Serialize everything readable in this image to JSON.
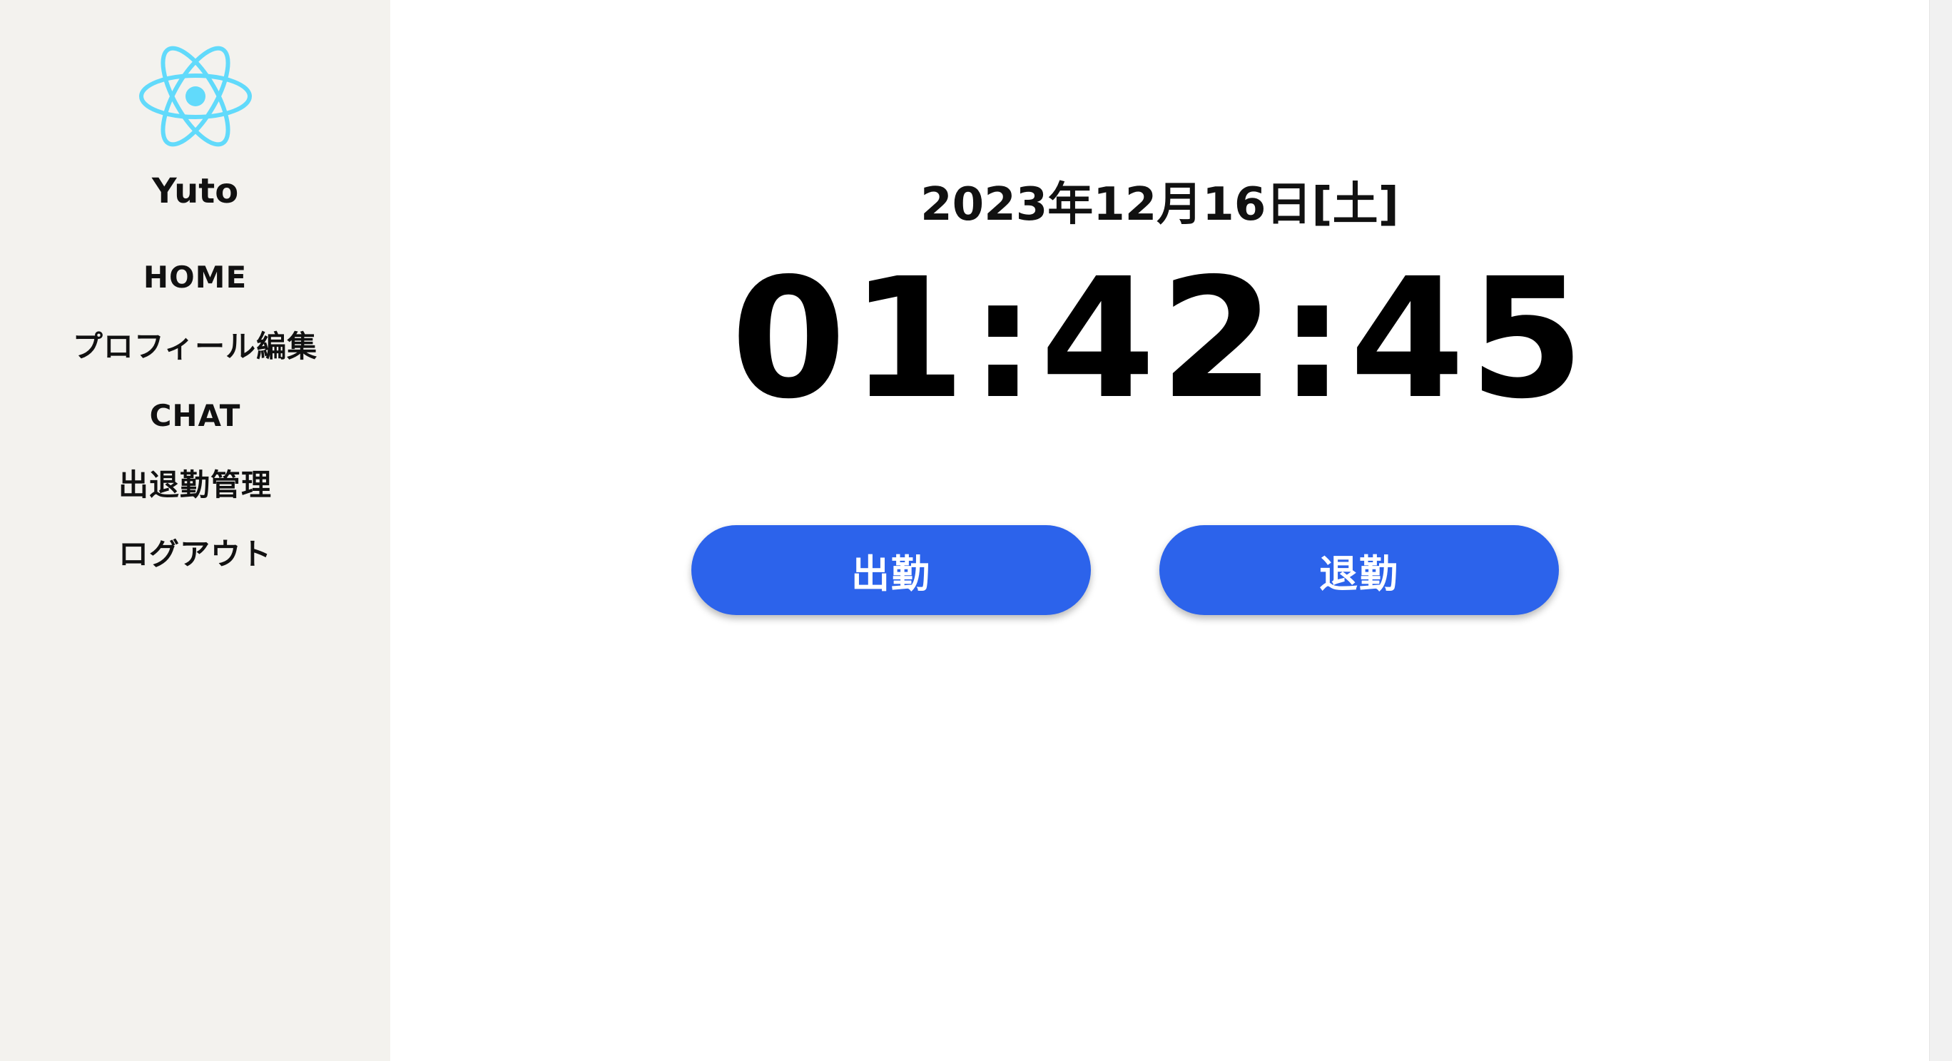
{
  "sidebar": {
    "logo_icon": "react-atom-icon",
    "logo_color": "#61dafb",
    "username": "Yuto",
    "items": [
      {
        "label": "HOME"
      },
      {
        "label": "プロフィール編集"
      },
      {
        "label": "CHAT"
      },
      {
        "label": "出退勤管理"
      },
      {
        "label": "ログアウト"
      }
    ]
  },
  "main": {
    "date": "2023年12月16日[土]",
    "time": "01:42:45",
    "clock_in_label": "出勤",
    "clock_out_label": "退勤"
  },
  "colors": {
    "sidebar_bg": "#f3f2ee",
    "button_bg": "#2c63eb",
    "button_text": "#ffffff"
  }
}
